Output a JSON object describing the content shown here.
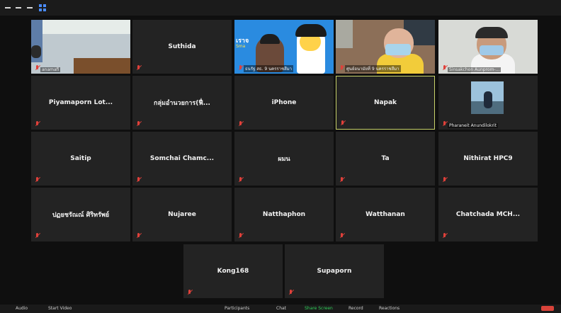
{
  "participants": [
    {
      "name": "",
      "caption": "anamafi",
      "video": true,
      "scene": "office"
    },
    {
      "name": "Suthida",
      "caption": "",
      "video": false
    },
    {
      "name": "",
      "caption": "ธนรัฐ สธ. 9 นครราชสีมา",
      "video": true,
      "scene": "cartoon"
    },
    {
      "name": "",
      "caption": "ศูนย์อนามัยที่ 9 นครราชสีมา",
      "video": true,
      "scene": "man-glasses"
    },
    {
      "name": "",
      "caption": "Sinsakchon Aunprom-...",
      "video": true,
      "scene": "man-headset"
    },
    {
      "name": "Piyamaporn Lot...",
      "caption": "",
      "video": false
    },
    {
      "name": "กลุ่มอำนวยการ(ฟื่...",
      "caption": "",
      "video": false
    },
    {
      "name": "iPhone",
      "caption": "",
      "video": false
    },
    {
      "name": "Napak",
      "caption": "",
      "video": false,
      "active": true
    },
    {
      "name": "",
      "caption": "Pharaneit Anundilokrit",
      "video": true,
      "scene": "photo"
    },
    {
      "name": "Saitip",
      "caption": "",
      "video": false
    },
    {
      "name": "Somchai Chamc...",
      "caption": "",
      "video": false
    },
    {
      "name": "ผมน",
      "caption": "",
      "video": false
    },
    {
      "name": "Ta",
      "caption": "",
      "video": false
    },
    {
      "name": "Nithirat HPC9",
      "caption": "",
      "video": false
    },
    {
      "name": "ปฏยชรัณณ์ ศิริทรัพย์",
      "caption": "",
      "video": false
    },
    {
      "name": "Nujaree",
      "caption": "",
      "video": false
    },
    {
      "name": "Natthaphon",
      "caption": "",
      "video": false
    },
    {
      "name": "Watthanan",
      "caption": "",
      "video": false
    },
    {
      "name": "Chatchada MCH...",
      "caption": "",
      "video": false
    },
    {
      "name": "Kong168",
      "caption": "",
      "video": false
    },
    {
      "name": "Supaporn",
      "caption": "",
      "video": false
    }
  ],
  "cartoon_text": {
    "line1": "เราจ",
    "line2": "Sma"
  },
  "toolbar": {
    "audio": "Audio",
    "start_video": "Start Video",
    "participants": "Participants",
    "chat": "Chat",
    "share_screen": "Share Screen",
    "record": "Record",
    "reactions": "Reactions"
  },
  "colors": {
    "active_border": "#c9d36a",
    "muted_mic": "#e0403a",
    "share": "#2fd05a",
    "accent": "#4a8cff"
  }
}
